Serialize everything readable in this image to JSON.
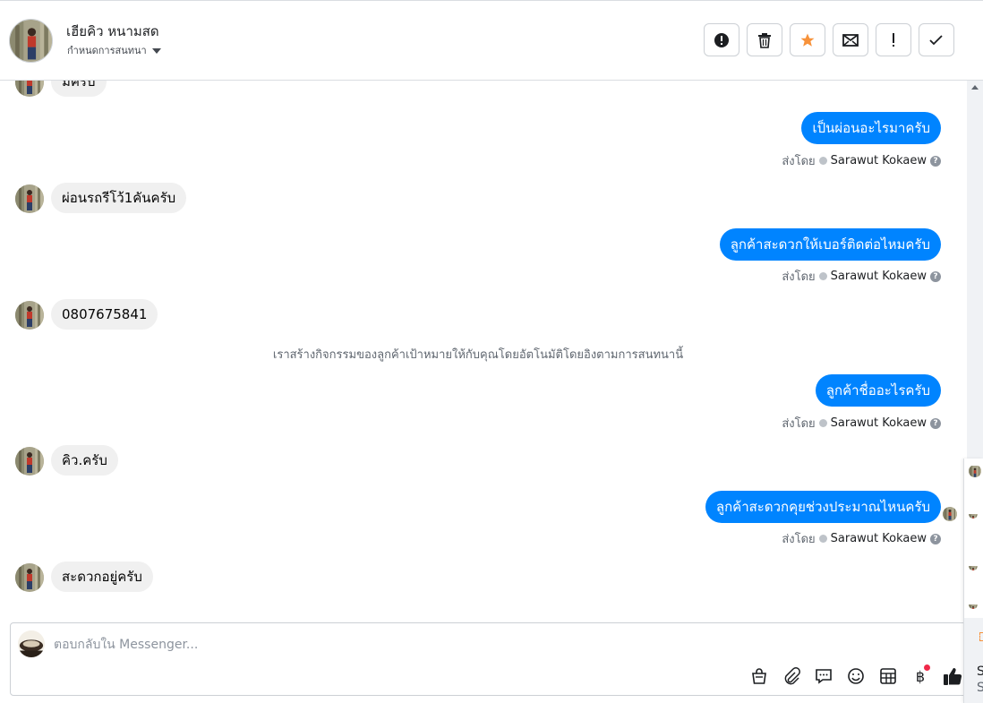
{
  "header": {
    "name": "เฮียคิว หนามสด",
    "subtitle": "กำหนดการสนทนา"
  },
  "actions": [
    {
      "name": "mark-spam-button",
      "icon": "alert-circle-icon"
    },
    {
      "name": "delete-button",
      "icon": "trash-icon"
    },
    {
      "name": "star-button",
      "icon": "star-icon"
    },
    {
      "name": "mark-unread-button",
      "icon": "envelope-icon"
    },
    {
      "name": "follow-up-button",
      "icon": "exclamation-icon"
    },
    {
      "name": "mark-done-button",
      "icon": "check-icon"
    }
  ],
  "messages": {
    "m0": "มีครับ",
    "m1": "เป็นผ่อนอะไรมาครับ",
    "m2": "ผ่อนรถรีโว้1คันครับ",
    "m3": "ลูกค้าสะดวกให้เบอร์ติดต่อไหมครับ",
    "m4": "0807675841",
    "m5": "ลูกค้าชื่ออะไรครับ",
    "m6": "คิว.ครับ",
    "m7": "ลูกค้าสะดวกคุยช่วงประมาณไหนครับ",
    "m8": "สะดวกอยู่ครับ"
  },
  "sent_by": {
    "label": "ส่งโดย",
    "agent": "Sarawut Kokaew"
  },
  "system_notice": "เราสร้างกิจกรรมของลูกค้าเป้าหมายให้กับคุณโดยอัตโนมัติโดยอิงตามการสนทนานี้",
  "composer": {
    "placeholder": "ตอบกลับใน Messenger..."
  },
  "tools": [
    "shopping-bag-icon",
    "paperclip-icon",
    "saved-reply-icon",
    "emoji-icon",
    "table-icon",
    "baht-payment-icon",
    "thumbs-up-icon"
  ],
  "side_panel": {
    "letter1": "S",
    "letter2": "S"
  },
  "colors": {
    "outgoing": "#0084ff",
    "incoming": "#f0f0f0",
    "star": "#f7923a"
  }
}
